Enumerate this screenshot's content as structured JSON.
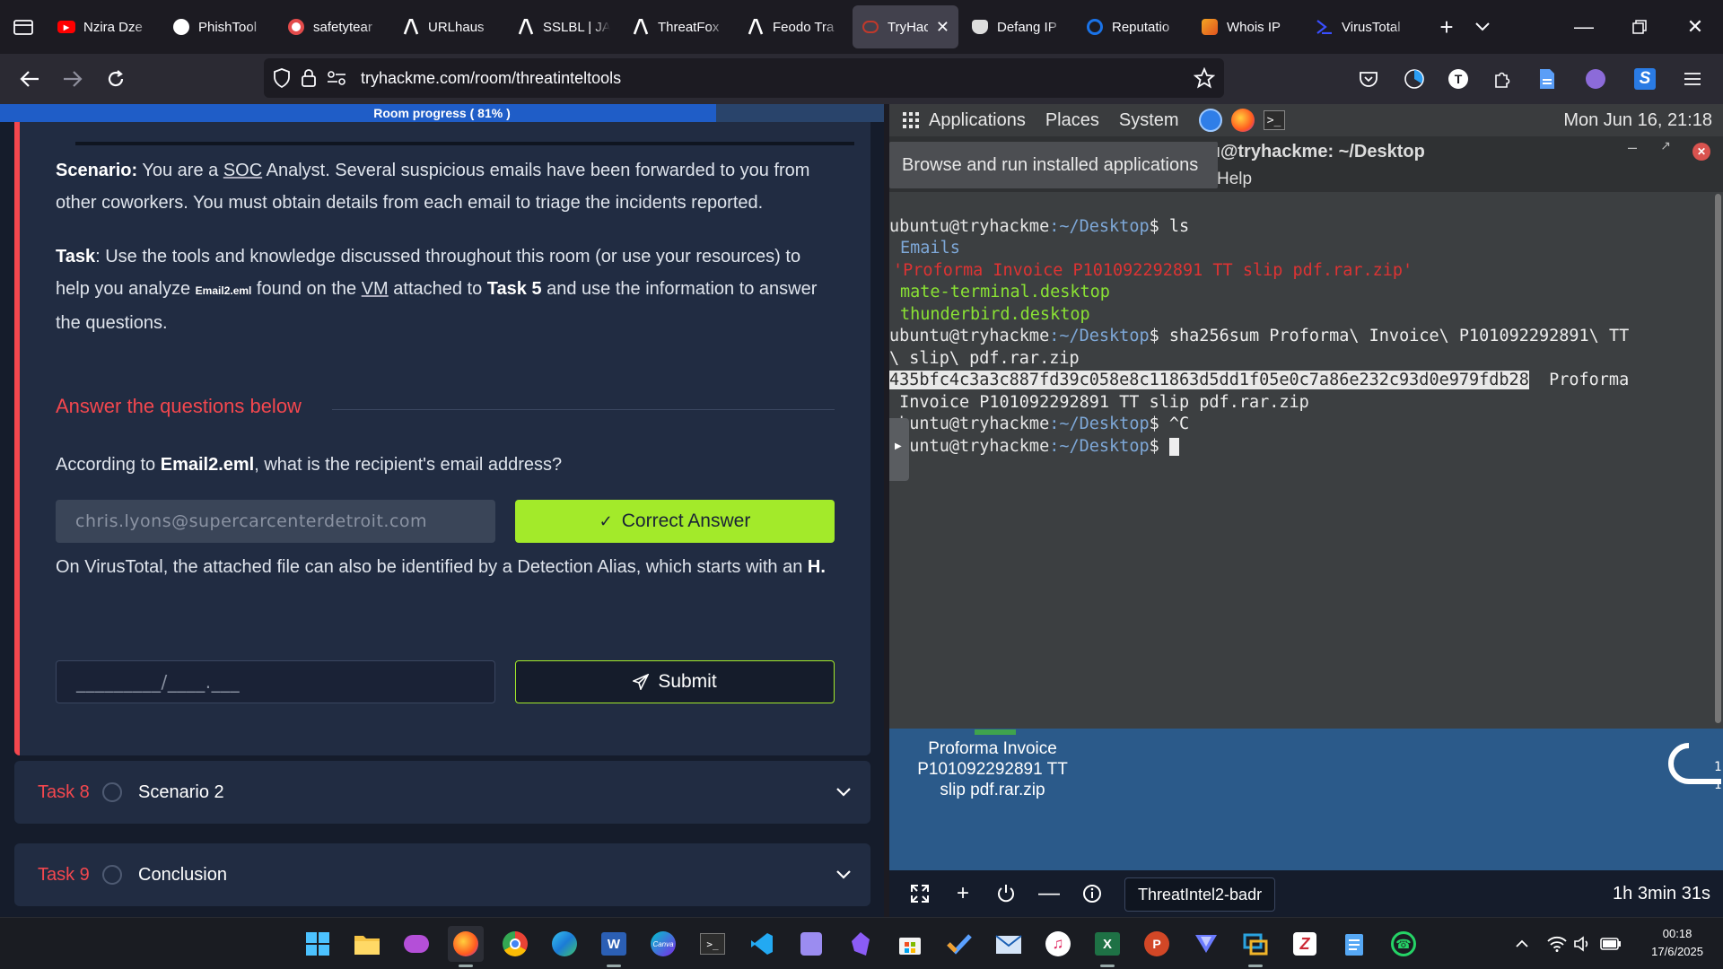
{
  "browser": {
    "tabs": [
      {
        "label": "Nzira Dze",
        "icon": "youtube-icon",
        "color": "#ff0000"
      },
      {
        "label": "PhishTool",
        "icon": "phishtool-icon",
        "color": "#ffffff"
      },
      {
        "label": "safetytear",
        "icon": "safetytear-icon",
        "color": "#e34b4b"
      },
      {
        "label": "URLhaus",
        "icon": "abuse-ch-icon",
        "color": "#ffffff"
      },
      {
        "label": "SSLBL | JA",
        "icon": "abuse-ch-icon",
        "color": "#ffffff"
      },
      {
        "label": "ThreatFox",
        "icon": "abuse-ch-icon",
        "color": "#ffffff"
      },
      {
        "label": "Feodo Tra",
        "icon": "abuse-ch-icon",
        "color": "#ffffff"
      },
      {
        "label": "TryHac",
        "icon": "tryhackme-icon",
        "color": "#c0392b",
        "active": true
      },
      {
        "label": "Defang IP",
        "icon": "defang-icon",
        "color": "#ffffff"
      },
      {
        "label": "Reputatio",
        "icon": "reputation-icon",
        "color": "#1a73e8"
      },
      {
        "label": "Whois IP",
        "icon": "whois-icon",
        "color": "#f5a623"
      },
      {
        "label": "VirusTotal",
        "icon": "virustotal-icon",
        "color": "#394eff"
      }
    ],
    "url": "tryhackme.com/room/threatinteltools"
  },
  "room": {
    "progress_label": "Room progress ( 81% )",
    "progress_fraction": 0.81,
    "scenario_label": "Scenario:",
    "scenario_text_a": " You are a ",
    "scenario_soc": "SOC",
    "scenario_text_b": " Analyst. Several suspicious emails have been forwarded to you from other coworkers. You must obtain details from each email to triage the incidents reported.",
    "task_label": "Task",
    "task_text_a": ": Use the tools and knowledge discussed throughout this room (or use your resources) to help you analyze ",
    "task_file": "Email2.eml",
    "task_text_b": " found on the ",
    "task_vm": "VM",
    "task_text_c": " attached to ",
    "task_ref": "Task 5",
    "task_text_d": " and use the information to answer the questions.",
    "answer_header": "Answer the questions below",
    "q1_a": "According to ",
    "q1_b": "Email2.eml",
    "q1_c": ", what is the recipient's email address?",
    "q1_answer": "chris.lyons@supercarcenterdetroit.com",
    "q1_button": "Correct Answer",
    "q2_a": "On VirusTotal, the attached file can also be identified by a Detection Alias, which starts with an ",
    "q2_b": "H.",
    "q2_placeholder": "_________/____.___",
    "q2_button": "Submit",
    "tasks": [
      {
        "num": "Task 8",
        "name": "Scenario 2"
      },
      {
        "num": "Task 9",
        "name": "Conclusion"
      }
    ]
  },
  "vm": {
    "panel_items": [
      "Applications",
      "Places",
      "System"
    ],
    "clock": "Mon Jun 16, 21:18",
    "tooltip": "Browse and run installed applications",
    "term_title": "tu@tryhackme: ~/Desktop",
    "term_menu_visible": "Help",
    "prompt_user": "ubuntu@tryhackme",
    "prompt_path": ":~/Desktop",
    "prompt_sign": "$ ",
    "lines": {
      "cmd1": "ls",
      "ls1": "Emails",
      "ls2": "'Proforma Invoice P101092292891 TT slip pdf.rar.zip'",
      "ls3": "mate-terminal.desktop",
      "ls4": "thunderbird.desktop",
      "cmd2": "sha256sum Proforma\\ Invoice\\ P101092292891\\ TT",
      "cmd2b": "\\ slip\\ pdf.rar.zip",
      "hash": "435bfc4c3a3c887fd39c058e8c11863d5dd1f05e0c7a86e232c93d0e979fdb28",
      "hash_tail": "  Proforma",
      "hash_cont": " Invoice P101092292891 TT slip pdf.rar.zip",
      "cmd3": "^C",
      "prompt4_user": "ubuntu@tryhackme"
    },
    "desktop_file": "Proforma Invoice P101092292891 TT slip pdf.rar.zip",
    "machine_name": "ThreatIntel2-badr",
    "timer": "1h 3min 31s"
  },
  "taskbar": {
    "time": "00:18",
    "date": "17/6/2025"
  }
}
